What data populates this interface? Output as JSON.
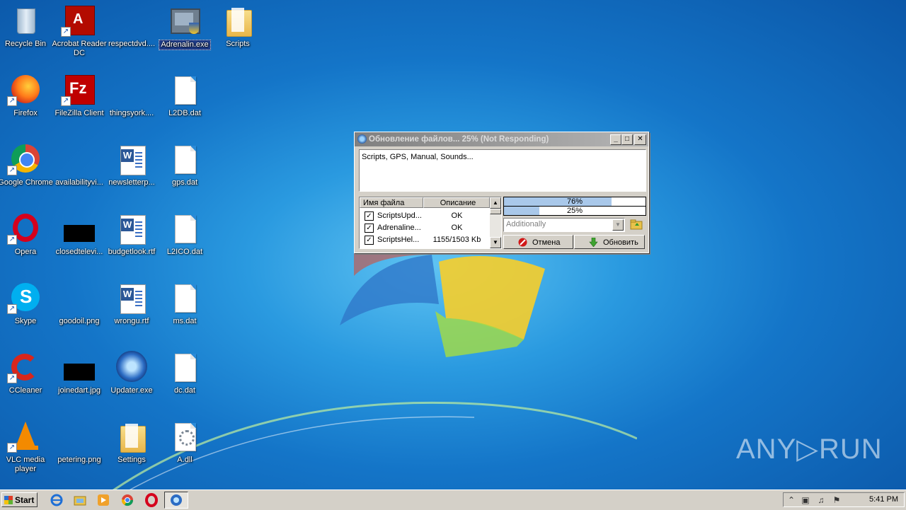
{
  "desktop": {
    "icons": [
      {
        "label": "Recycle Bin"
      },
      {
        "label": "Acrobat Reader DC"
      },
      {
        "label": "respectdvd...."
      },
      {
        "label": "Adrenalin.exe"
      },
      {
        "label": "Scripts"
      },
      {
        "label": "Firefox"
      },
      {
        "label": "FileZilla Client"
      },
      {
        "label": "thingsyork...."
      },
      {
        "label": "L2DB.dat"
      },
      {
        "label": "Google Chrome"
      },
      {
        "label": "availabilityvi..."
      },
      {
        "label": "newsletterp..."
      },
      {
        "label": "gps.dat"
      },
      {
        "label": "Opera"
      },
      {
        "label": "closedtelevi..."
      },
      {
        "label": "budgetlook.rtf"
      },
      {
        "label": "L2ICO.dat"
      },
      {
        "label": "Skype"
      },
      {
        "label": "goodoil.png"
      },
      {
        "label": "wrongu.rtf"
      },
      {
        "label": "ms.dat"
      },
      {
        "label": "CCleaner"
      },
      {
        "label": "joinedart.jpg"
      },
      {
        "label": "Updater.exe"
      },
      {
        "label": "dc.dat"
      },
      {
        "label": "VLC media player"
      },
      {
        "label": "petering.png"
      },
      {
        "label": "Settings"
      },
      {
        "label": "A.dll"
      }
    ]
  },
  "dialog": {
    "title": "Обновление файлов... 25% (Not Responding)",
    "info_text": "Scripts, GPS, Manual, Sounds...",
    "list": {
      "col_name": "Имя файла",
      "col_desc": "Описание",
      "rows": [
        {
          "name": "ScriptsUpd...",
          "desc": "OK"
        },
        {
          "name": "Adrenaline...",
          "desc": "OK"
        },
        {
          "name": "ScriptsHel...",
          "desc": "1155/1503 Kb"
        }
      ]
    },
    "progress_total": {
      "text": "76%",
      "value": 0.76
    },
    "progress_file": {
      "text": "25%",
      "value": 0.25
    },
    "combo_value": "Additionally",
    "cancel_label": "Отмена",
    "update_label": "Обновить",
    "title_buttons": {
      "min": "_",
      "max": "□",
      "close": "✕"
    }
  },
  "taskbar": {
    "start_label": "Start",
    "clock": "5:41 PM"
  },
  "watermark": "ANY▷RUN"
}
